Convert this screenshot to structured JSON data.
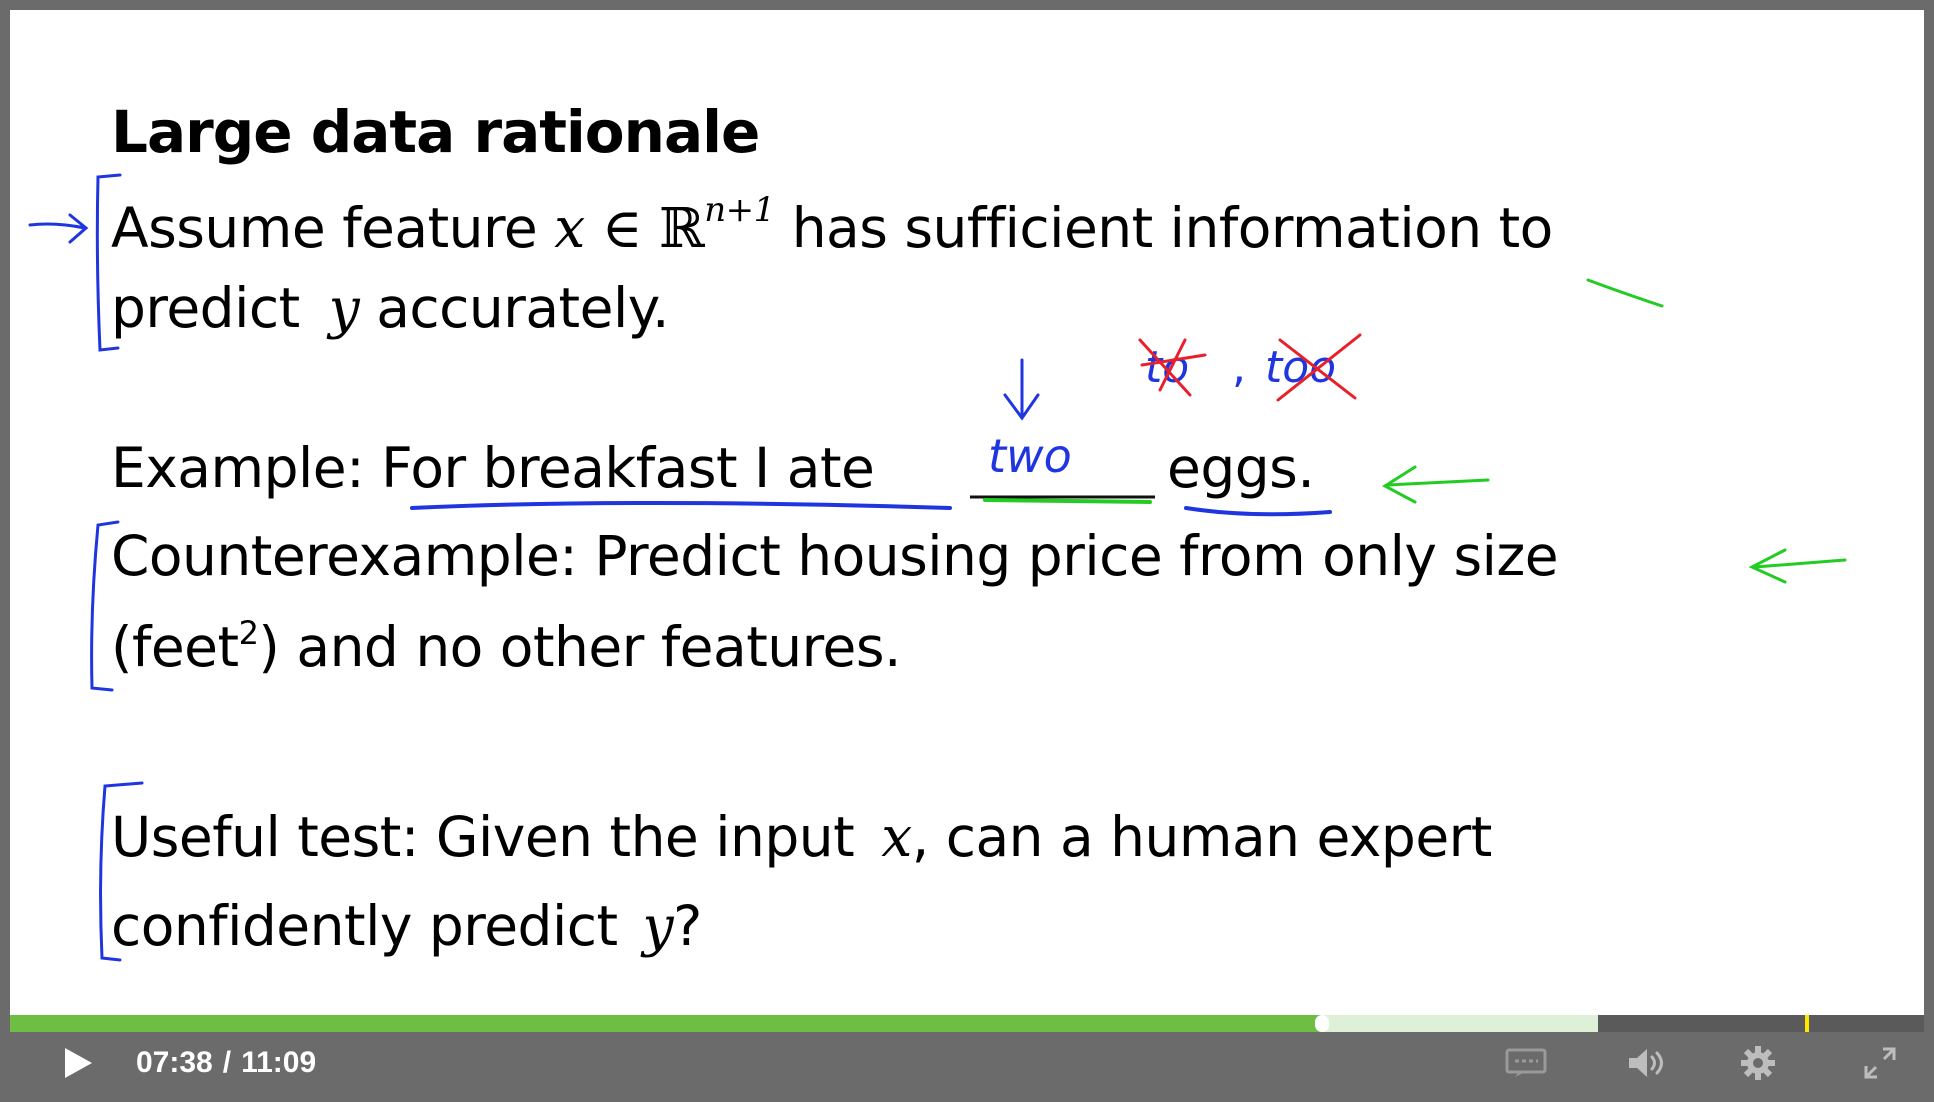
{
  "slide": {
    "title": "Large data rationale",
    "assume": {
      "line1_prefix": "Assume feature",
      "math_x": "x",
      "math_in": "∈",
      "math_R": "ℝ",
      "math_exp": "n+1",
      "line1_suffix": "has sufficient information to",
      "line2_prefix": "predict",
      "math_y": "y",
      "line2_suffix": "accurately."
    },
    "example": {
      "label": "Example:",
      "phrase": "For breakfast I ate",
      "blank": "_____",
      "end": "eggs."
    },
    "counter": {
      "line1": "Counterexample: Predict housing price from only size",
      "line2_prefix": "(feet",
      "sup": "2",
      "line2_suffix": ") and no other features."
    },
    "useful": {
      "line1_prefix": "Useful test: Given the input",
      "math_x": "x",
      "line1_suffix": ", can a human expert",
      "line2_prefix": "confidently predict",
      "math_y": "y",
      "line2_suffix": "?"
    },
    "handwriting": {
      "blank_answer": "two",
      "crossed_1": "to",
      "crossed_2": "too",
      "comma": ","
    }
  },
  "player": {
    "current_time": "07:38",
    "separator": "/",
    "duration": "11:09",
    "progress_fraction": 0.6856,
    "buffered_fraction": 0.8296,
    "colors": {
      "played": "#6fbe44",
      "buffered": "#dff0d8",
      "cue": "#ffe600",
      "bar": "#6b6b6b"
    },
    "icons": [
      "play-icon",
      "captions-icon",
      "volume-icon",
      "settings-icon",
      "fullscreen-icon"
    ]
  }
}
